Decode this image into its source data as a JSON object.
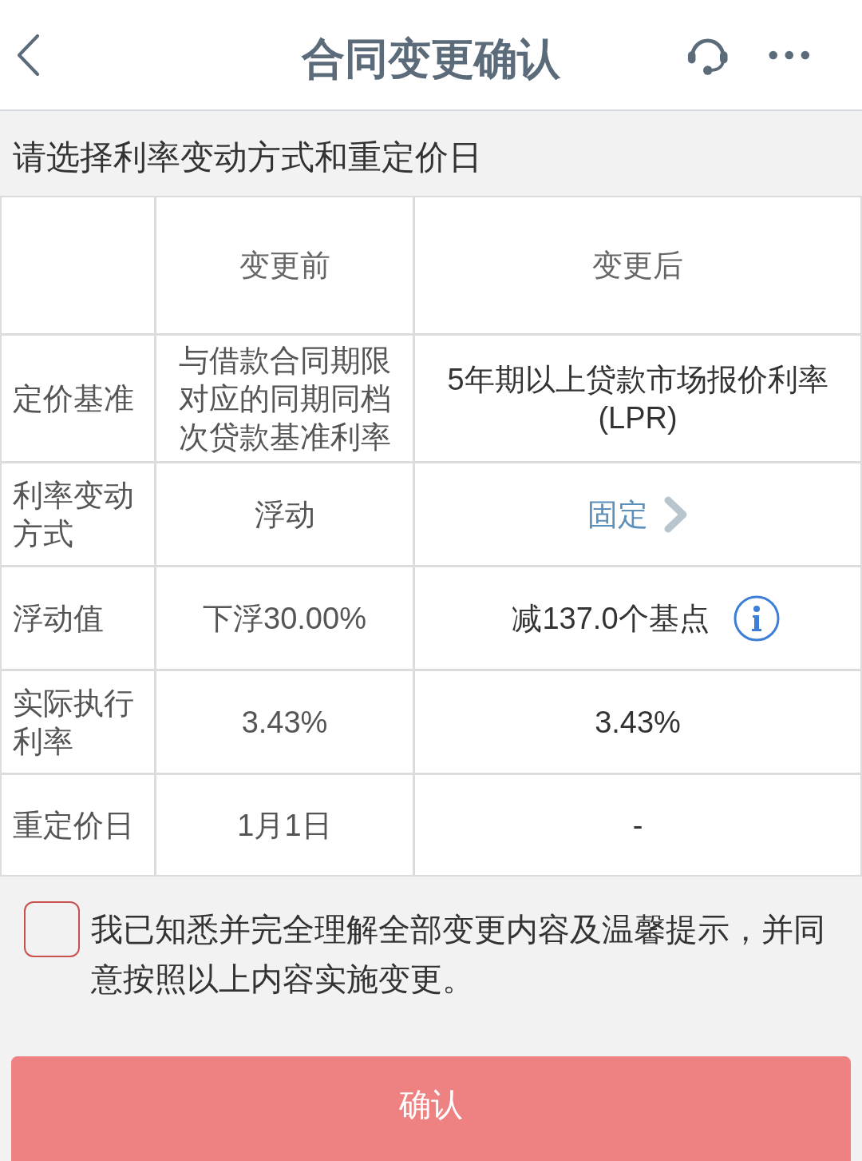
{
  "header": {
    "title": "合同变更确认"
  },
  "section": {
    "title": "请选择利率变动方式和重定价日"
  },
  "table": {
    "columns": [
      {
        "label": "变更前"
      },
      {
        "label": "变更后"
      }
    ],
    "rows": [
      {
        "kind": "text",
        "label": "定价基准",
        "before": "与借款合同期限对应的同期同档次贷款基准利率",
        "after": "5年期以上贷款市场报价利率(LPR)"
      },
      {
        "kind": "select",
        "label": "利率变动方式",
        "before": "浮动",
        "after": "固定"
      },
      {
        "kind": "info",
        "label": "浮动值",
        "before": "下浮30.00%",
        "after": "减137.0个基点"
      },
      {
        "kind": "text",
        "label": "实际执行利率",
        "before": "3.43%",
        "after": "3.43%"
      },
      {
        "kind": "text",
        "label": "重定价日",
        "before": "1月1日",
        "after": "-"
      }
    ]
  },
  "agreement": {
    "checked": false,
    "text": "我已知悉并完全理解全部变更内容及温馨提示，并同意按照以上内容实施变更。"
  },
  "confirm_button": {
    "label": "确认"
  }
}
